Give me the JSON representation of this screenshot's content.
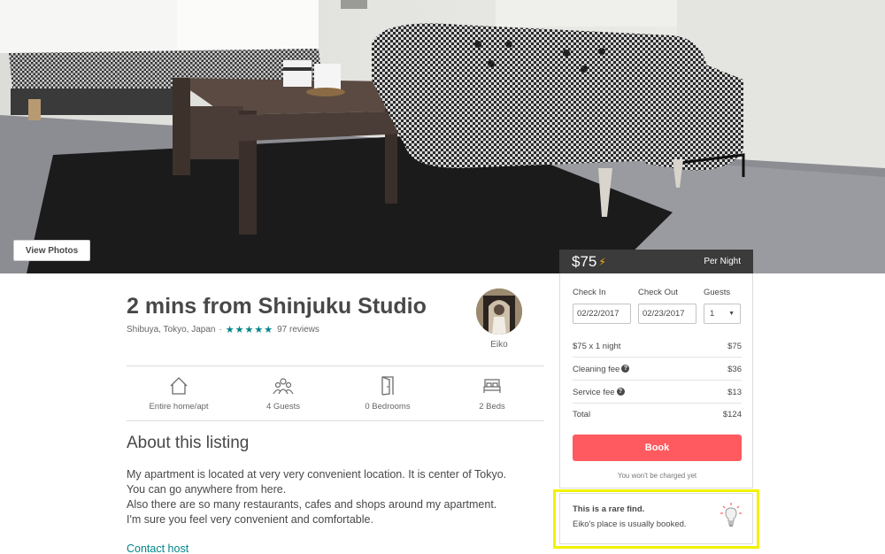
{
  "hero": {
    "view_photos_label": "View Photos"
  },
  "pricing": {
    "price": "$75",
    "period": "Per Night",
    "instant_icon": "lightning-bolt-icon"
  },
  "listing": {
    "title": "2 mins from Shinjuku Studio",
    "location": "Shibuya, Tokyo, Japan",
    "separator": "·",
    "rating": 4.5,
    "stars": "★★★★★",
    "reviews": "97 reviews",
    "host_name": "Eiko"
  },
  "amenities": [
    {
      "icon": "house-icon",
      "label": "Entire home/apt"
    },
    {
      "icon": "guests-icon",
      "label": "4 Guests"
    },
    {
      "icon": "door-icon",
      "label": "0 Bedrooms"
    },
    {
      "icon": "bed-icon",
      "label": "2 Beds"
    }
  ],
  "about": {
    "title": "About this listing",
    "lines": [
      "My apartment is located at very very convenient location. It is center of Tokyo.",
      "You can go anywhere from here.",
      "Also there are so many restaurants, cafes and shops around my apartment.",
      "I'm sure you feel very convenient and comfortable."
    ],
    "contact_label": "Contact host"
  },
  "booking": {
    "check_in_label": "Check In",
    "check_out_label": "Check Out",
    "guests_label": "Guests",
    "check_in": "02/22/2017",
    "check_out": "02/23/2017",
    "guests": "1",
    "fees": [
      {
        "label": "$75 x 1 night",
        "value": "$75",
        "help": false
      },
      {
        "label": "Cleaning fee",
        "value": "$36",
        "help": true
      },
      {
        "label": "Service fee",
        "value": "$13",
        "help": true
      },
      {
        "label": "Total",
        "value": "$124",
        "help": false
      }
    ],
    "book_label": "Book",
    "no_charge_note": "You won't be charged yet"
  },
  "rare_find": {
    "title": "This is a rare find.",
    "subtitle": "Eiko's place is usually booked.",
    "icon": "lightbulb-icon"
  },
  "colors": {
    "accent": "#ff5a5f",
    "teal": "#008489",
    "highlight": "#f2f200",
    "price_bar": "#3b3b3b"
  }
}
